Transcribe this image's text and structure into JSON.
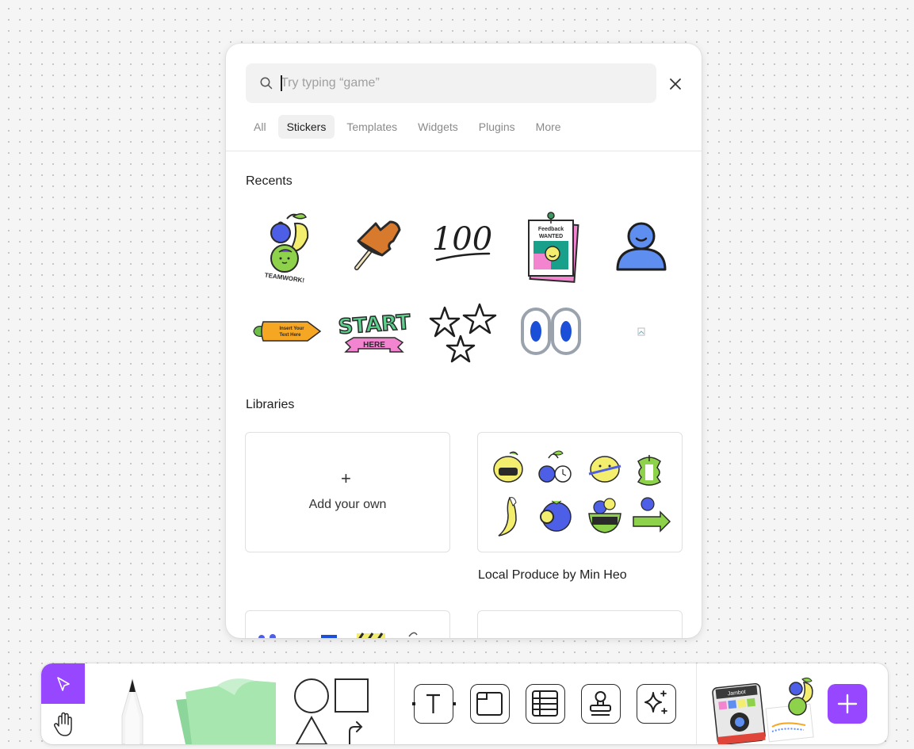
{
  "search": {
    "placeholder": "Try typing “game”",
    "value": ""
  },
  "tabs": [
    {
      "label": "All",
      "active": false
    },
    {
      "label": "Stickers",
      "active": true
    },
    {
      "label": "Templates",
      "active": false
    },
    {
      "label": "Widgets",
      "active": false
    },
    {
      "label": "Plugins",
      "active": false
    },
    {
      "label": "More",
      "active": false
    }
  ],
  "recents": {
    "title": "Recents",
    "stickers": [
      {
        "icon": "teamwork-fruit-sticker",
        "text": "TEAMWORK!"
      },
      {
        "icon": "pushpin-sticker"
      },
      {
        "icon": "hundred-sticker",
        "text": "100"
      },
      {
        "icon": "feedback-wanted-sticker",
        "text": "Feedback WANTED"
      },
      {
        "icon": "person-avatar-sticker"
      },
      {
        "icon": "carrot-text-sticker",
        "text": "Insert Your Text Here"
      },
      {
        "icon": "start-here-sticker",
        "text_1": "START",
        "text_2": "HERE"
      },
      {
        "icon": "stars-sticker"
      },
      {
        "icon": "googly-eyes-sticker"
      },
      {
        "icon": "broken-image-icon"
      }
    ]
  },
  "libraries": {
    "title": "Libraries",
    "add_own_label": "Add your own",
    "items": [
      {
        "name": "Local Produce by Min Heo"
      }
    ]
  },
  "toolbar": {
    "tools": [
      "move-tool",
      "hand-tool",
      "pencil-tool",
      "sticky-note-tool",
      "shapes-tool",
      "text-tool",
      "section-tool",
      "table-tool",
      "stamp-tool",
      "ai-sparkle-tool",
      "add-button"
    ],
    "jambot_label": "Jambot"
  },
  "colors": {
    "accent": "#9747ff",
    "canvas": "#f5f5f5",
    "sticky_green": "#a8e6b0",
    "produce_green": "#8ed14b",
    "produce_blue": "#4c5fe6",
    "produce_yellow": "#f4ee6f"
  }
}
